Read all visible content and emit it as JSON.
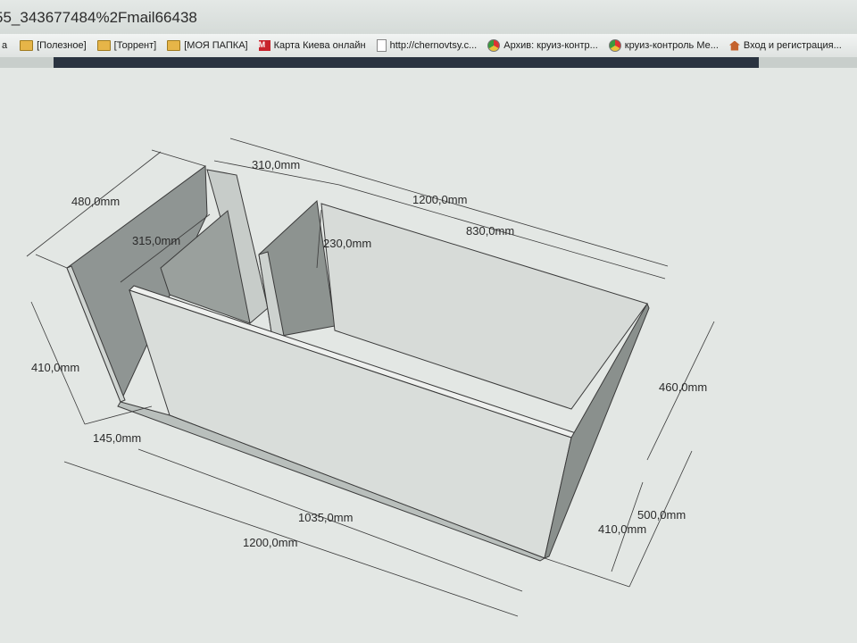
{
  "browser": {
    "address_text": "55_343677484%2Fmail66438",
    "bookmarks_prefix": "a",
    "bookmarks": [
      {
        "label": "[Полезное]",
        "icon": "folder-icon"
      },
      {
        "label": "[Торрент]",
        "icon": "folder-icon"
      },
      {
        "label": "[МОЯ ПАПКА]",
        "icon": "folder-icon"
      },
      {
        "label": "Карта Киева онлайн",
        "icon": "maps-icon"
      },
      {
        "label": "http://chernovtsy.c...",
        "icon": "page-icon"
      },
      {
        "label": "Архив: круиз-контр...",
        "icon": "chrome-icon"
      },
      {
        "label": "круиз-контроль Ме...",
        "icon": "chrome-icon"
      },
      {
        "label": "Вход и регистрация...",
        "icon": "home-icon"
      }
    ]
  },
  "drawing": {
    "dimensions": {
      "top_depth": "480,0mm",
      "partition_gap": "310,0mm",
      "top_length": "1200,0mm",
      "inner_length": "830,0mm",
      "inner_depth": "315,0mm",
      "partition_depth": "230,0mm",
      "left_height": "410,0mm",
      "right_height": "460,0mm",
      "offset": "145,0mm",
      "front_length": "1035,0mm",
      "bottom_length": "1200,0mm",
      "front_height": "410,0mm",
      "outer_height": "500,0mm"
    }
  }
}
